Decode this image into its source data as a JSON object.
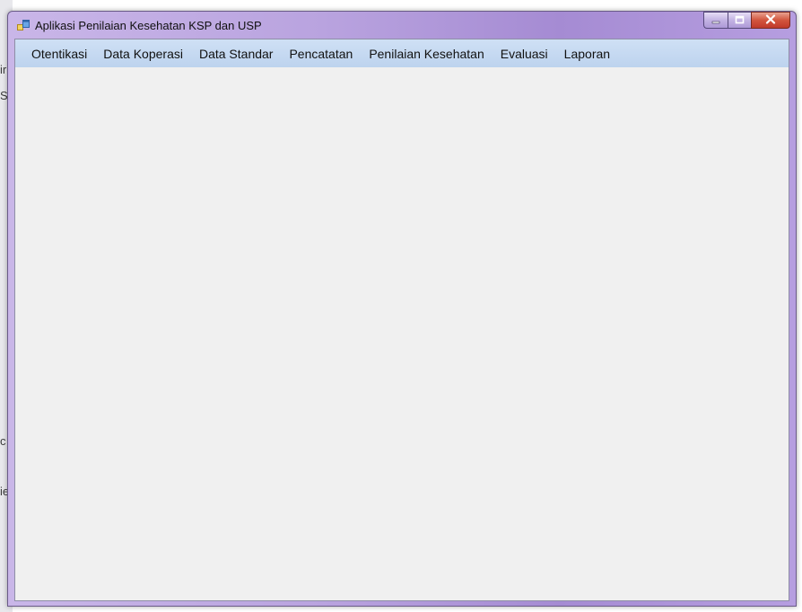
{
  "window": {
    "title": "Aplikasi Penilaian Kesehatan KSP dan USP",
    "icon": "app-window-icon",
    "controls": {
      "minimize": "minimize-icon",
      "maximize": "maximize-icon",
      "close": "close-icon"
    }
  },
  "menu": {
    "items": [
      {
        "label": "Otentikasi"
      },
      {
        "label": "Data Koperasi"
      },
      {
        "label": "Data Standar"
      },
      {
        "label": "Pencatatan"
      },
      {
        "label": "Penilaian Kesehatan"
      },
      {
        "label": "Evaluasi"
      },
      {
        "label": "Laporan"
      }
    ]
  },
  "background": {
    "glyph_1": "ir",
    "glyph_2": "St",
    "glyph_3": "c",
    "glyph_4": "ie"
  },
  "colors": {
    "titlebar": "#b9a3df",
    "menubar": "#c6d9f1",
    "client": "#f0f0f0",
    "close": "#c0392b"
  }
}
